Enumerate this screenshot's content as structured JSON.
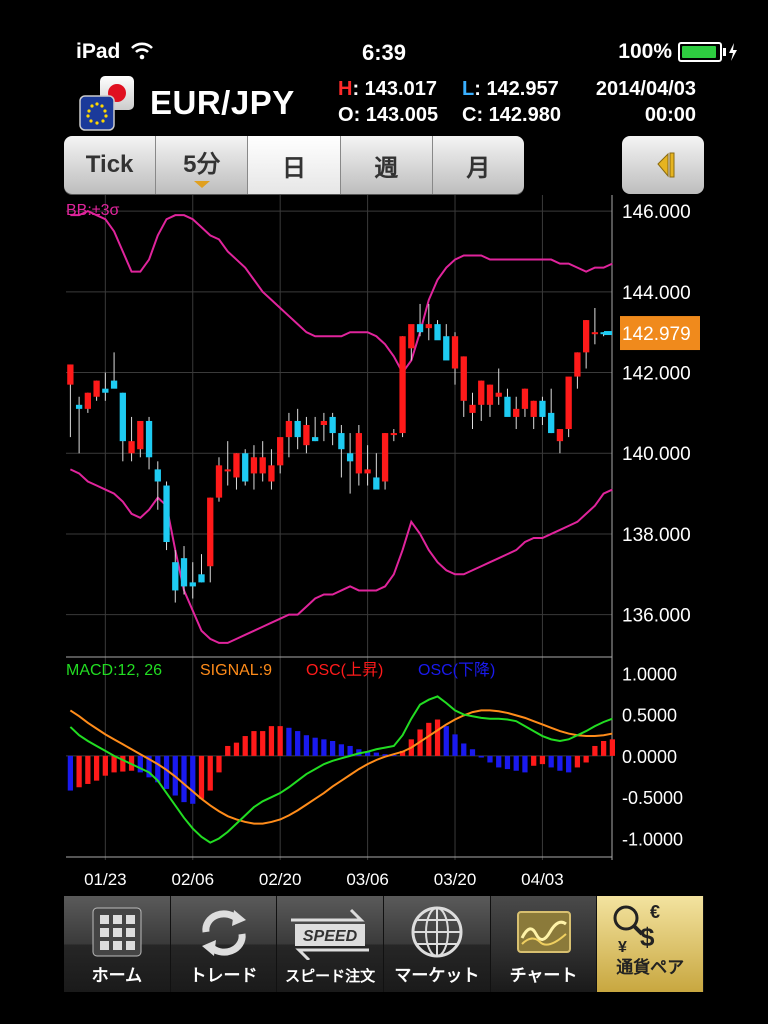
{
  "status": {
    "device": "iPad",
    "time": "6:39",
    "battery": "100%",
    "battery_level": 1.0
  },
  "header": {
    "pair": "EUR/JPY",
    "high_label": "H",
    "high": "143.017",
    "low_label": "L",
    "low": "142.957",
    "open_label": "O",
    "open": "143.005",
    "close_label": "C",
    "close": "142.980",
    "date": "2014/04/03",
    "time": "00:00"
  },
  "tabs": [
    {
      "label": "Tick",
      "active": false
    },
    {
      "label": "5分",
      "active": false,
      "dropdown": true
    },
    {
      "label": "日",
      "active": true
    },
    {
      "label": "週",
      "active": false
    },
    {
      "label": "月",
      "active": false
    }
  ],
  "side_button_icon": "collapse-left-icon",
  "colors": {
    "up": "#ff1a1a",
    "down": "#1ecbf2",
    "band": "#e0249c",
    "macd": "#22dd22",
    "signal": "#ff8c1a",
    "osc_up": "#ff1a1a",
    "osc_down": "#1a1aee",
    "price_tag": "#f08a1c"
  },
  "chart_data": [
    {
      "type": "candlestick",
      "indicator_label": "BB:±3σ",
      "ylim": [
        135.0,
        146.4
      ],
      "y_ticks": [
        "146.000",
        "144.000",
        "142.000",
        "140.000",
        "138.000",
        "136.000"
      ],
      "y_tick_values": [
        146,
        144,
        142,
        140,
        138,
        136
      ],
      "current_price": "142.979",
      "current_value": 142.979,
      "x_labels": [
        "01/23",
        "02/06",
        "02/20",
        "03/06",
        "03/20",
        "04/03"
      ],
      "x_label_index": [
        4,
        14,
        24,
        34,
        44,
        54
      ],
      "candles": [
        [
          141.7,
          142.2,
          140.4,
          142.2
        ],
        [
          141.2,
          141.4,
          140.0,
          141.1
        ],
        [
          141.1,
          141.5,
          141.0,
          141.5
        ],
        [
          141.4,
          141.8,
          141.3,
          141.8
        ],
        [
          141.6,
          142.0,
          141.3,
          141.5
        ],
        [
          141.8,
          142.5,
          141.7,
          141.6
        ],
        [
          141.5,
          141.5,
          139.8,
          140.3
        ],
        [
          140.0,
          140.9,
          139.8,
          140.3
        ],
        [
          140.1,
          140.5,
          139.9,
          140.8
        ],
        [
          140.8,
          140.9,
          139.6,
          139.9
        ],
        [
          139.6,
          139.8,
          138.6,
          139.3
        ],
        [
          139.2,
          139.3,
          137.6,
          137.8
        ],
        [
          137.3,
          137.6,
          136.3,
          136.6
        ],
        [
          137.4,
          137.7,
          136.5,
          136.7
        ],
        [
          136.8,
          137.3,
          136.4,
          136.7
        ],
        [
          137.0,
          137.5,
          136.8,
          136.8
        ],
        [
          137.2,
          138.9,
          136.8,
          138.9
        ],
        [
          138.9,
          139.9,
          138.8,
          139.7
        ],
        [
          139.6,
          140.3,
          139.2,
          139.6
        ],
        [
          139.4,
          140.0,
          139.1,
          140.0
        ],
        [
          140.0,
          140.1,
          139.2,
          139.3
        ],
        [
          139.5,
          140.2,
          139.1,
          139.9
        ],
        [
          139.5,
          140.3,
          139.3,
          139.9
        ],
        [
          139.3,
          140.1,
          139.1,
          139.7
        ],
        [
          139.7,
          140.1,
          139.5,
          140.4
        ],
        [
          140.4,
          141.0,
          139.9,
          140.8
        ],
        [
          140.8,
          141.1,
          140.1,
          140.4
        ],
        [
          140.2,
          140.9,
          140.0,
          140.7
        ],
        [
          140.4,
          140.9,
          140.3,
          140.3
        ],
        [
          140.7,
          141.0,
          140.3,
          140.8
        ],
        [
          140.9,
          141.0,
          140.2,
          140.5
        ],
        [
          140.5,
          140.7,
          139.4,
          140.1
        ],
        [
          140.0,
          140.5,
          139.0,
          139.8
        ],
        [
          139.5,
          140.7,
          139.2,
          140.5
        ],
        [
          139.5,
          140.2,
          139.2,
          139.6
        ],
        [
          139.4,
          140.0,
          139.2,
          139.1
        ],
        [
          139.3,
          140.5,
          139.1,
          140.5
        ],
        [
          140.5,
          140.6,
          140.3,
          140.5
        ],
        [
          140.5,
          142.9,
          140.4,
          142.9
        ],
        [
          142.6,
          143.0,
          142.3,
          143.2
        ],
        [
          143.2,
          143.7,
          142.9,
          143.0
        ],
        [
          143.1,
          143.7,
          142.8,
          143.2
        ],
        [
          143.2,
          143.3,
          142.9,
          142.8
        ],
        [
          142.9,
          143.2,
          142.5,
          142.3
        ],
        [
          142.1,
          143.0,
          141.7,
          142.9
        ],
        [
          141.3,
          142.4,
          140.9,
          142.4
        ],
        [
          141.0,
          141.5,
          140.6,
          141.2
        ],
        [
          141.2,
          141.8,
          140.8,
          141.8
        ],
        [
          141.2,
          141.7,
          140.9,
          141.7
        ],
        [
          141.4,
          142.1,
          141.2,
          141.5
        ],
        [
          141.4,
          141.6,
          141.0,
          140.9
        ],
        [
          140.9,
          141.4,
          140.6,
          141.1
        ],
        [
          141.1,
          141.6,
          140.9,
          141.6
        ],
        [
          140.9,
          141.3,
          140.6,
          141.3
        ],
        [
          141.3,
          141.4,
          140.7,
          140.9
        ],
        [
          141.0,
          141.6,
          140.5,
          140.5
        ],
        [
          140.3,
          140.6,
          140.0,
          140.6
        ],
        [
          140.6,
          141.8,
          140.4,
          141.9
        ],
        [
          141.9,
          142.5,
          141.6,
          142.5
        ],
        [
          142.5,
          143.3,
          142.1,
          143.3
        ],
        [
          143.0,
          143.6,
          142.7,
          143.0
        ],
        [
          143.0,
          143.0,
          142.9,
          142.98
        ]
      ],
      "band_upper": [
        145.9,
        145.9,
        146.0,
        145.9,
        145.8,
        145.5,
        145.0,
        144.5,
        144.5,
        144.8,
        145.4,
        145.8,
        145.9,
        145.9,
        145.8,
        145.6,
        145.4,
        145.3,
        145.0,
        144.8,
        144.6,
        144.3,
        144.0,
        143.8,
        143.6,
        143.4,
        143.2,
        143.0,
        142.9,
        142.9,
        142.9,
        142.9,
        143.0,
        143.0,
        143.0,
        142.9,
        142.7,
        142.4,
        142.0,
        142.3,
        143.0,
        143.8,
        144.3,
        144.6,
        144.8,
        144.9,
        144.9,
        144.9,
        144.8,
        144.8,
        144.8,
        144.8,
        144.8,
        144.8,
        144.8,
        144.8,
        144.7,
        144.7,
        144.6,
        144.5,
        144.6,
        144.6,
        144.7
      ],
      "band_lower": [
        139.6,
        139.5,
        139.3,
        139.2,
        139.1,
        139.0,
        138.8,
        138.5,
        138.4,
        138.6,
        138.9,
        138.7,
        137.6,
        136.6,
        136.1,
        135.6,
        135.4,
        135.3,
        135.3,
        135.4,
        135.5,
        135.6,
        135.7,
        135.8,
        135.9,
        136.0,
        136.0,
        136.2,
        136.4,
        136.5,
        136.5,
        136.6,
        136.7,
        136.6,
        136.6,
        136.6,
        136.7,
        137.0,
        137.6,
        138.3,
        138.0,
        137.6,
        137.3,
        137.1,
        137.0,
        137.0,
        137.1,
        137.2,
        137.3,
        137.4,
        137.5,
        137.6,
        137.8,
        137.9,
        137.9,
        138.0,
        138.1,
        138.2,
        138.3,
        138.5,
        138.7,
        139.0,
        139.1
      ]
    },
    {
      "type": "macd",
      "legend": [
        {
          "label": "MACD:12, 26",
          "color_key": "macd"
        },
        {
          "label": "SIGNAL:9",
          "color_key": "signal"
        },
        {
          "label": "OSC(上昇)",
          "color_key": "osc_up"
        },
        {
          "label": "OSC(下降)",
          "color_key": "osc_down"
        }
      ],
      "ylim": [
        -1.2,
        1.1
      ],
      "y_ticks": [
        "1.0000",
        "0.5000",
        "0.0000",
        "-0.5000",
        "-1.0000"
      ],
      "y_tick_values": [
        1.0,
        0.5,
        0.0,
        -0.5,
        -1.0
      ],
      "macd": [
        0.35,
        0.25,
        0.18,
        0.12,
        0.06,
        0.0,
        -0.05,
        -0.1,
        -0.15,
        -0.2,
        -0.3,
        -0.45,
        -0.6,
        -0.75,
        -0.88,
        -0.98,
        -1.05,
        -1.0,
        -0.92,
        -0.82,
        -0.72,
        -0.62,
        -0.55,
        -0.5,
        -0.45,
        -0.38,
        -0.3,
        -0.22,
        -0.16,
        -0.1,
        -0.06,
        -0.03,
        0.0,
        0.03,
        0.05,
        0.08,
        0.1,
        0.12,
        0.25,
        0.45,
        0.62,
        0.68,
        0.72,
        0.64,
        0.55,
        0.5,
        0.48,
        0.46,
        0.45,
        0.45,
        0.44,
        0.42,
        0.36,
        0.3,
        0.24,
        0.2,
        0.18,
        0.2,
        0.25,
        0.3,
        0.36,
        0.41,
        0.45
      ],
      "signal": [
        0.55,
        0.48,
        0.4,
        0.33,
        0.26,
        0.2,
        0.14,
        0.08,
        0.02,
        -0.04,
        -0.1,
        -0.17,
        -0.25,
        -0.34,
        -0.43,
        -0.52,
        -0.6,
        -0.67,
        -0.73,
        -0.77,
        -0.8,
        -0.82,
        -0.82,
        -0.8,
        -0.77,
        -0.72,
        -0.66,
        -0.59,
        -0.52,
        -0.45,
        -0.37,
        -0.3,
        -0.23,
        -0.16,
        -0.1,
        -0.05,
        -0.01,
        0.02,
        0.05,
        0.1,
        0.17,
        0.24,
        0.31,
        0.38,
        0.44,
        0.49,
        0.53,
        0.55,
        0.55,
        0.54,
        0.52,
        0.49,
        0.46,
        0.42,
        0.38,
        0.34,
        0.3,
        0.27,
        0.25,
        0.24,
        0.24,
        0.25,
        0.27
      ],
      "osc": [
        -0.42,
        -0.38,
        -0.34,
        -0.3,
        -0.24,
        -0.2,
        -0.19,
        -0.18,
        -0.2,
        -0.26,
        -0.32,
        -0.4,
        -0.48,
        -0.56,
        -0.58,
        -0.52,
        -0.42,
        -0.2,
        0.12,
        0.16,
        0.24,
        0.3,
        0.3,
        0.36,
        0.36,
        0.34,
        0.3,
        0.25,
        0.22,
        0.2,
        0.18,
        0.14,
        0.12,
        0.08,
        0.05,
        0.04,
        0.02,
        0.01,
        0.06,
        0.2,
        0.32,
        0.4,
        0.44,
        0.36,
        0.26,
        0.15,
        0.08,
        -0.02,
        -0.08,
        -0.14,
        -0.16,
        -0.18,
        -0.2,
        -0.12,
        -0.1,
        -0.14,
        -0.18,
        -0.2,
        -0.14,
        -0.08,
        0.12,
        0.18,
        0.2
      ]
    }
  ],
  "nav": [
    {
      "label": "ホーム",
      "icon": "grid-icon"
    },
    {
      "label": "トレード",
      "icon": "refresh-icon"
    },
    {
      "label": "スピード注文",
      "icon": "speed-icon"
    },
    {
      "label": "マーケット",
      "icon": "globe-icon"
    },
    {
      "label": "チャート",
      "icon": "chart-icon",
      "active": true
    },
    {
      "label": "通貨ペア",
      "icon": "currency-icon",
      "gold": true
    }
  ]
}
